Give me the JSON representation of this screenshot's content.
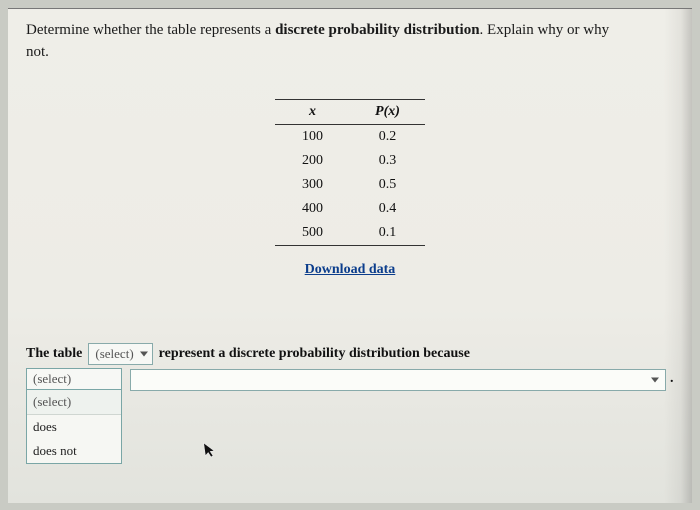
{
  "question": {
    "line1_a": "Determine whether the table represents a ",
    "line1_b": "discrete probability distribution",
    "line1_c": ". Explain why or why",
    "line2": "not."
  },
  "table": {
    "header_x": "x",
    "header_px": "P(x)",
    "rows": [
      {
        "x": "100",
        "p": "0.2"
      },
      {
        "x": "200",
        "p": "0.3"
      },
      {
        "x": "300",
        "p": "0.5"
      },
      {
        "x": "400",
        "p": "0.4"
      },
      {
        "x": "500",
        "p": "0.1"
      }
    ]
  },
  "download_label": "Download data",
  "answer": {
    "prefix": "The table",
    "select1_placeholder": "(select)",
    "mid": "represent a discrete probability distribution because",
    "select2_placeholder": "(select)",
    "period": ".",
    "dropdown": {
      "header": "(select)",
      "options": [
        "does",
        "does not"
      ]
    }
  },
  "chart_data": {
    "type": "table",
    "title": "Probability distribution table",
    "columns": [
      "x",
      "P(x)"
    ],
    "x": [
      100,
      200,
      300,
      400,
      500
    ],
    "p": [
      0.2,
      0.3,
      0.5,
      0.4,
      0.1
    ]
  }
}
